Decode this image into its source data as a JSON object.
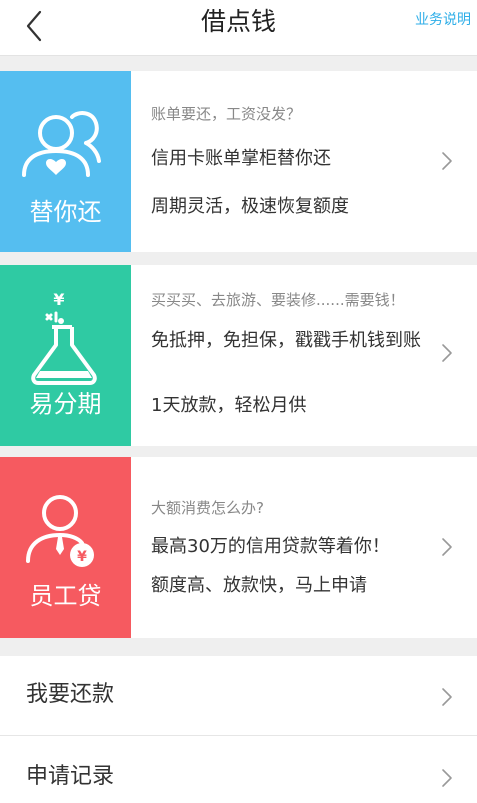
{
  "header": {
    "title": "借点钱",
    "help_link": "业务说明"
  },
  "colors": {
    "blue": "#55bef0",
    "green": "#2fcaa3",
    "red": "#f65a60",
    "link": "#2eaee8"
  },
  "cards": [
    {
      "label": "替你还",
      "icon": "users-heart-icon",
      "subtitle": "账单要还，工资没发？",
      "lines": [
        "信用卡账单掌柜替你还",
        "周期灵活，极速恢复额度"
      ]
    },
    {
      "label": "易分期",
      "icon": "flask-yen-icon",
      "subtitle": "买买买、去旅游、要装修......需要钱！",
      "lines": [
        "免抵押，免担保，戳戳手机钱到账",
        "1天放款，轻松月供"
      ]
    },
    {
      "label": "员工贷",
      "icon": "employee-yen-icon",
      "subtitle": "大额消费怎么办?",
      "lines": [
        "最高30万的信用贷款等着你！",
        "额度高、放款快，马上申请"
      ]
    }
  ],
  "menu": [
    {
      "label": "我要还款"
    },
    {
      "label": "申请记录"
    }
  ]
}
